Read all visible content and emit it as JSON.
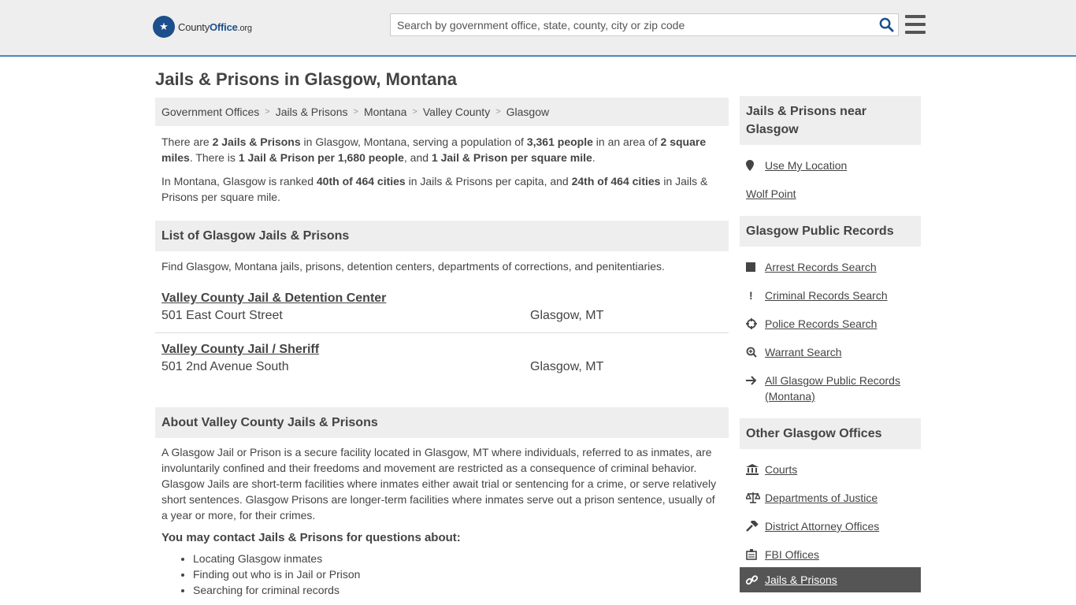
{
  "header": {
    "logo_prefix": "County",
    "logo_brand": "Office",
    "logo_suffix": ".org",
    "search_placeholder": "Search by government office, state, county, city or zip code"
  },
  "page_title": "Jails & Prisons in Glasgow, Montana",
  "breadcrumb": [
    "Government Offices",
    "Jails & Prisons",
    "Montana",
    "Valley County",
    "Glasgow"
  ],
  "intro": {
    "p1": {
      "a": "There are ",
      "b1": "2 Jails & Prisons",
      "c": " in Glasgow, Montana, serving a population of ",
      "b2": "3,361 people",
      "d": " in an area of ",
      "b3": "2 square miles",
      "e": ". There is ",
      "b4": "1 Jail & Prison per 1,680 people",
      "f": ", and ",
      "b5": "1 Jail & Prison per square mile",
      "g": "."
    },
    "p2": {
      "a": "In Montana, Glasgow is ranked ",
      "b1": "40th of 464 cities",
      "c": " in Jails & Prisons per capita, and ",
      "b2": "24th of 464 cities",
      "d": " in Jails & Prisons per square mile."
    }
  },
  "list_section": {
    "heading": "List of Glasgow Jails & Prisons",
    "description": "Find Glasgow, Montana jails, prisons, detention centers, departments of corrections, and penitentiaries.",
    "listings": [
      {
        "name": "Valley County Jail & Detention Center",
        "address": "501 East Court Street",
        "city": "Glasgow, MT"
      },
      {
        "name": "Valley County Jail / Sheriff",
        "address": "501 2nd Avenue South",
        "city": "Glasgow, MT"
      }
    ]
  },
  "about": {
    "heading": "About Valley County Jails & Prisons",
    "body": "A Glasgow Jail or Prison is a secure facility located in Glasgow, MT where individuals, referred to as inmates, are involuntarily confined and their freedoms and movement are restricted as a consequence of criminal behavior. Glasgow Jails are short-term facilities where inmates either await trial or sentencing for a crime, or serve relatively short sentences. Glasgow Prisons are longer-term facilities where inmates serve out a prison sentence, usually of a year or more, for their crimes.",
    "contact_heading": "You may contact Jails & Prisons for questions about:",
    "bullets": [
      "Locating Glasgow inmates",
      "Finding out who is in Jail or Prison",
      "Searching for criminal records"
    ]
  },
  "sidebar": {
    "near": {
      "heading": "Jails & Prisons near Glasgow",
      "use_location": "Use My Location",
      "places": [
        "Wolf Point"
      ]
    },
    "records": {
      "heading": "Glasgow Public Records",
      "items": [
        {
          "label": "Arrest Records Search",
          "icon": "square-icon"
        },
        {
          "label": "Criminal Records Search",
          "icon": "exclamation-icon"
        },
        {
          "label": "Police Records Search",
          "icon": "crosshair-icon"
        },
        {
          "label": "Warrant Search",
          "icon": "magnify-plus-icon"
        },
        {
          "label": "All Glasgow Public Records (Montana)",
          "icon": "arrow-right-icon"
        }
      ]
    },
    "other": {
      "heading": "Other Glasgow Offices",
      "items": [
        {
          "label": "Courts",
          "icon": "courthouse-icon"
        },
        {
          "label": "Departments of Justice",
          "icon": "scales-icon"
        },
        {
          "label": "District Attorney Offices",
          "icon": "gavel-icon"
        },
        {
          "label": "FBI Offices",
          "icon": "badge-icon"
        },
        {
          "label": "Jails & Prisons",
          "icon": "link-icon",
          "active": true
        }
      ]
    }
  },
  "colors": {
    "accent_bar": "#4b86c4",
    "logo_blue": "#1c4f8c",
    "panel_gray": "#eeeeee",
    "active_item": "#555555",
    "search_icon": "#1c4f8c"
  }
}
